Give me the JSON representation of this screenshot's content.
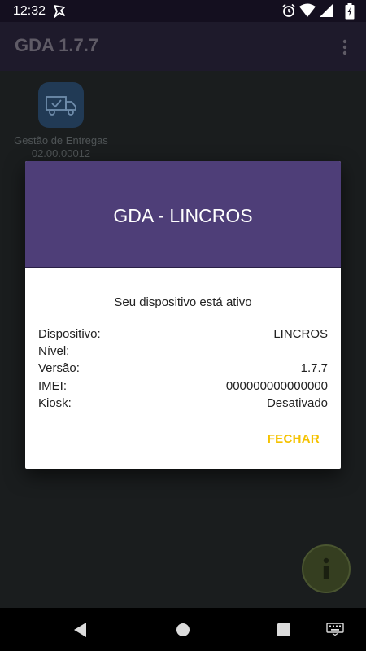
{
  "status_bar": {
    "time": "12:32",
    "icons": [
      "navigation-app-icon",
      "alarm-icon",
      "wifi-icon",
      "signal-icon",
      "battery-icon"
    ]
  },
  "app_bar": {
    "title": "GDA 1.7.7",
    "overflow_icon": "more-vert-icon"
  },
  "launcher": {
    "label": "Gestão de Entregas",
    "version": "02.00.00012",
    "icon": "delivery-truck-icon"
  },
  "dialog": {
    "title": "GDA - LINCROS",
    "message": "Seu dispositivo está ativo",
    "rows": [
      {
        "label": "Dispositivo:",
        "value": "LINCROS"
      },
      {
        "label": "Nível:",
        "value": ""
      },
      {
        "label": "Versão:",
        "value": "1.7.7"
      },
      {
        "label": "IMEI:",
        "value": "000000000000000"
      },
      {
        "label": "Kiosk:",
        "value": "Desativado"
      }
    ],
    "close_label": "FECHAR"
  },
  "fab": {
    "icon": "info-icon"
  },
  "nav_bar": {
    "icons": [
      "back-icon",
      "home-icon",
      "recents-icon",
      "keyboard-icon"
    ]
  },
  "colors": {
    "header": "#4e3e78",
    "accent": "#f5c200",
    "app_bar": "#1e1a2b"
  }
}
